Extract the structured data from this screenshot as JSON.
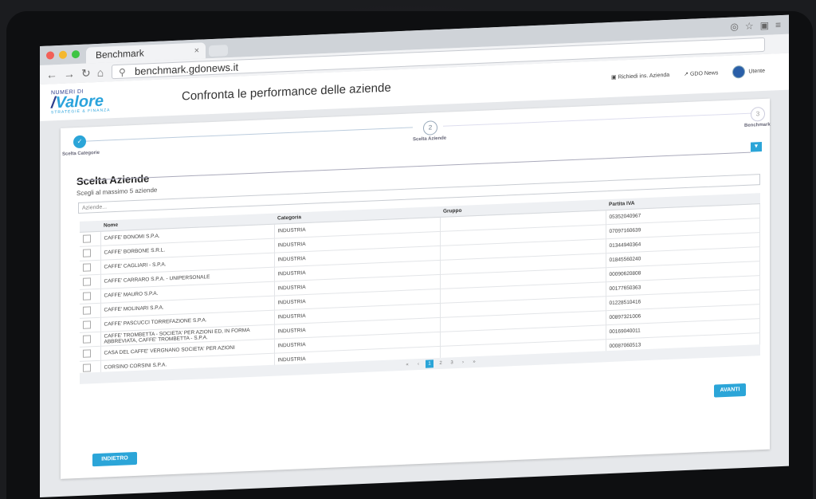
{
  "browser": {
    "tab_title": "Benchmark",
    "tab_close": "×",
    "url": "benchmark.gdonews.it"
  },
  "header": {
    "logo_small": "NUMERI DI",
    "logo_main": "Valore",
    "logo_sub": "STRATEGIE & FINANZA",
    "page_title": "Confronta le performance delle aziende",
    "links": [
      {
        "label": "Richiedi ins. Azienda",
        "icon": "external-box-icon"
      },
      {
        "label": "GDO News",
        "icon": "external-link-icon"
      },
      {
        "label": "Utente",
        "icon": "avatar"
      }
    ]
  },
  "stepper": {
    "steps": [
      {
        "label": "Scelta Categorie",
        "state": "done",
        "symbol": "✓"
      },
      {
        "label": "Scelta Aziende",
        "state": "current",
        "symbol": "2"
      },
      {
        "label": "Benchmark",
        "state": "pending",
        "symbol": "3"
      }
    ]
  },
  "section": {
    "title": "Scelta Aziende",
    "subtitle": "Scegli al massimo 5 aziende",
    "search_placeholder": "Aziende..."
  },
  "table": {
    "columns": [
      "",
      "Nome",
      "Categoria",
      "Gruppo",
      "Partita IVA"
    ],
    "rows": [
      {
        "nome": "CAFFE' BONOMI S.P.A.",
        "categoria": "INDUSTRIA",
        "gruppo": "",
        "piva": "05352040967"
      },
      {
        "nome": "CAFFE' BORBONE S.R.L.",
        "categoria": "INDUSTRIA",
        "gruppo": "",
        "piva": "07097160639"
      },
      {
        "nome": "CAFFE' CAGLIARI - S.P.A.",
        "categoria": "INDUSTRIA",
        "gruppo": "",
        "piva": "01344940364"
      },
      {
        "nome": "CAFFE' CARRARO S.P.A. - UNIPERSONALE",
        "categoria": "INDUSTRIA",
        "gruppo": "",
        "piva": "01845560240"
      },
      {
        "nome": "CAFFE' MAURO S.P.A.",
        "categoria": "INDUSTRIA",
        "gruppo": "",
        "piva": "00090620808"
      },
      {
        "nome": "CAFFE' MOLINARI S.P.A.",
        "categoria": "INDUSTRIA",
        "gruppo": "",
        "piva": "00177650363"
      },
      {
        "nome": "CAFFE' PASCUCCI TORREFAZIONE S.P.A.",
        "categoria": "INDUSTRIA",
        "gruppo": "",
        "piva": "01228510416"
      },
      {
        "nome": "CAFFE' TROMBETTA - SOCIETA' PER AZIONI ED, IN FORMA ABBREVIATA, CAFFE' TROMBETTA - S.P.A.",
        "categoria": "INDUSTRIA",
        "gruppo": "",
        "piva": "00897321006"
      },
      {
        "nome": "CASA DEL CAFFE' VERGNANO SOCIETA' PER AZIONI",
        "categoria": "INDUSTRIA",
        "gruppo": "",
        "piva": "00169040011"
      },
      {
        "nome": "CORSINO CORSINI S.P.A.",
        "categoria": "INDUSTRIA",
        "gruppo": "",
        "piva": "00087060513"
      }
    ]
  },
  "pagination": {
    "first": "«",
    "prev": "‹",
    "pages": [
      "1",
      "2",
      "3"
    ],
    "active_page": "1",
    "next": "›",
    "last": "»"
  },
  "buttons": {
    "next_label": "AVANTI",
    "back_label": "INDIETRO"
  },
  "colors": {
    "accent": "#2ba5d8",
    "brand_dark": "#2d3d8c",
    "step_done": "#2ba5d8"
  }
}
